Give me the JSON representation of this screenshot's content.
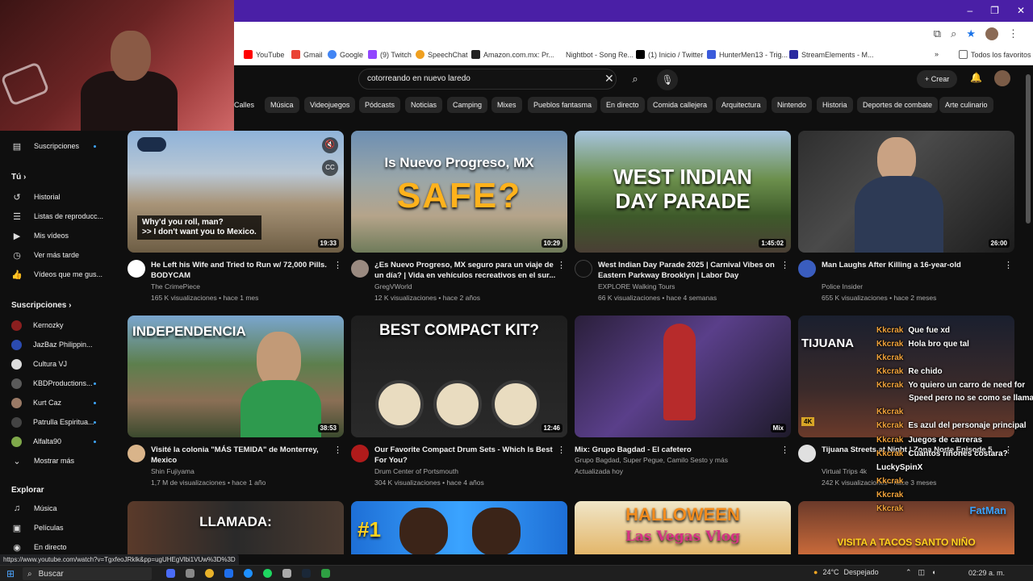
{
  "browser": {
    "bookmarks": [
      "YouTube",
      "Gmail",
      "Google",
      "(9) Twitch",
      "SpeechChat",
      "Amazon.com.mx: Pr...",
      "Nightbot - Song Re...",
      "(1) Inicio / Twitter",
      "HunterMen13 - Trig...",
      "StreamElements - M..."
    ],
    "all_favorites": "Todos los favoritos",
    "more_bookmarks": "»",
    "status_url": "https://www.youtube.com/watch?v=TgxfeoJRklk&pp=ugUHEgVlbi1VUw%3D%3D"
  },
  "header": {
    "search_value": "cotorreando en nuevo laredo",
    "create_label": "Crear"
  },
  "chips": [
    "Calles",
    "Música",
    "Videojuegos",
    "Pódcasts",
    "Noticias",
    "Camping",
    "Mixes",
    "Pueblos fantasma",
    "En directo",
    "Comida callejera",
    "Arquitectura",
    "Nintendo",
    "Historia",
    "Deportes de combate",
    "Arte culinario"
  ],
  "sidebar": {
    "top_item": "Suscripciones",
    "you_header": "Tú",
    "you_items": [
      "Historial",
      "Listas de reproducc...",
      "Mis vídeos",
      "Ver más tarde",
      "Vídeos que me gus..."
    ],
    "subs_header": "Suscripciones",
    "subs_items": [
      "Kernozky",
      "JazBaz Philippin...",
      "Cultura VJ",
      "KBDProductions...",
      "Kurt Caz",
      "Patrulla Espiritua...",
      "Alfalta90"
    ],
    "show_more": "Mostrar más",
    "explore_header": "Explorar",
    "explore_items": [
      "Música",
      "Películas",
      "En directo"
    ]
  },
  "videos": [
    {
      "title": "He Left his Wife and Tried to Run w/ 72,000 Pills. BODYCAM",
      "channel": "The CrimePiece",
      "stats": "165 K visualizaciones • hace 1 mes",
      "duration": "19:33",
      "caption1": "Why'd you roll, man?",
      "caption2": ">> I don't want you to Mexico."
    },
    {
      "title": "¿Es Nuevo Progreso, MX seguro para un viaje de un día? | Vida en vehículos recreativos en el sur...",
      "channel": "GregVWorld",
      "stats": "12 K visualizaciones • hace 2 años",
      "duration": "10:29",
      "overlay1": "Is Nuevo Progreso, MX",
      "overlay2": "SAFE?"
    },
    {
      "title": "West Indian Day Parade 2025 | Carnival Vibes on Eastern Parkway Brooklyn | Labor Day",
      "channel": "EXPLORE Walking Tours",
      "stats": "66 K visualizaciones • hace 4 semanas",
      "duration": "1:45:02",
      "overlay1": "WEST INDIAN",
      "overlay2": "DAY PARADE"
    },
    {
      "title": "Man Laughs After Killing a 16-year-old",
      "channel": "Police Insider",
      "stats": "655 K visualizaciones • hace 2 meses",
      "duration": "26:00"
    },
    {
      "title": "Visité la colonia \"MÁS TEMIDA\" de Monterrey, Mexico",
      "channel": "Shin Fujiyama",
      "stats": "1,7 M de visualizaciones • hace 1 año",
      "duration": "38:53",
      "overlay1": "INDEPENDENCIA"
    },
    {
      "title": "Our Favorite Compact Drum Sets - Which Is Best For You?",
      "channel": "Drum Center of Portsmouth",
      "stats": "304 K visualizaciones • hace 4 años",
      "duration": "12:46",
      "overlay1": "BEST COMPACT KIT?"
    },
    {
      "title": "Mix: Grupo Bagdad - El cafetero",
      "channel": "Grupo Bagdad, Super Pegue, Camilo Sesto y más",
      "stats": "Actualizada hoy",
      "duration": "Mix"
    },
    {
      "title": "Tijuana Streets at Night | Zona Norte Episode 5",
      "channel": "Virtual Trips 4k",
      "stats": "242 K visualizaciones • hace 3 meses",
      "duration": "",
      "overlay1": "TIJUANA"
    },
    {
      "overlay1": "LLAMADA:"
    },
    {
      "overlay1": "#1"
    },
    {
      "overlay1": "HALLOWEEN",
      "overlay2": "Las Vegas Vlog"
    },
    {
      "overlay1": "VISITA A TACOS SANTO NIÑO",
      "overlay2": "FatMan"
    }
  ],
  "chat": [
    {
      "user": "Kkcrak",
      "msg": "Que fue xd"
    },
    {
      "user": "Kkcrak",
      "msg": "Hola bro que tal"
    },
    {
      "user": "Kkcrak",
      "msg": ""
    },
    {
      "user": "Kkcrak",
      "msg": "Re chido"
    },
    {
      "user": "Kkcrak",
      "msg": "Yo quiero un carro de need for"
    },
    {
      "user": "",
      "msg": "Speed pero no se como se llama"
    },
    {
      "user": "Kkcrak",
      "msg": ""
    },
    {
      "user": "Kkcrak",
      "msg": "Es azul del personaje principal"
    },
    {
      "user": "Kkcrak",
      "msg": "Juegos de carreras"
    },
    {
      "user": "Kkcrak",
      "msg": "Cuantos riñones costara?"
    },
    {
      "user": "LuckySpinX",
      "msg": ""
    },
    {
      "user": "Kkcrak",
      "msg": ""
    },
    {
      "user": "Kkcrak",
      "msg": ""
    },
    {
      "user": "Kkcrak",
      "msg": ""
    }
  ],
  "taskbar": {
    "search_label": "Buscar",
    "temperature": "24°C",
    "weather": "Despejado",
    "time": "02:29 a. m."
  }
}
